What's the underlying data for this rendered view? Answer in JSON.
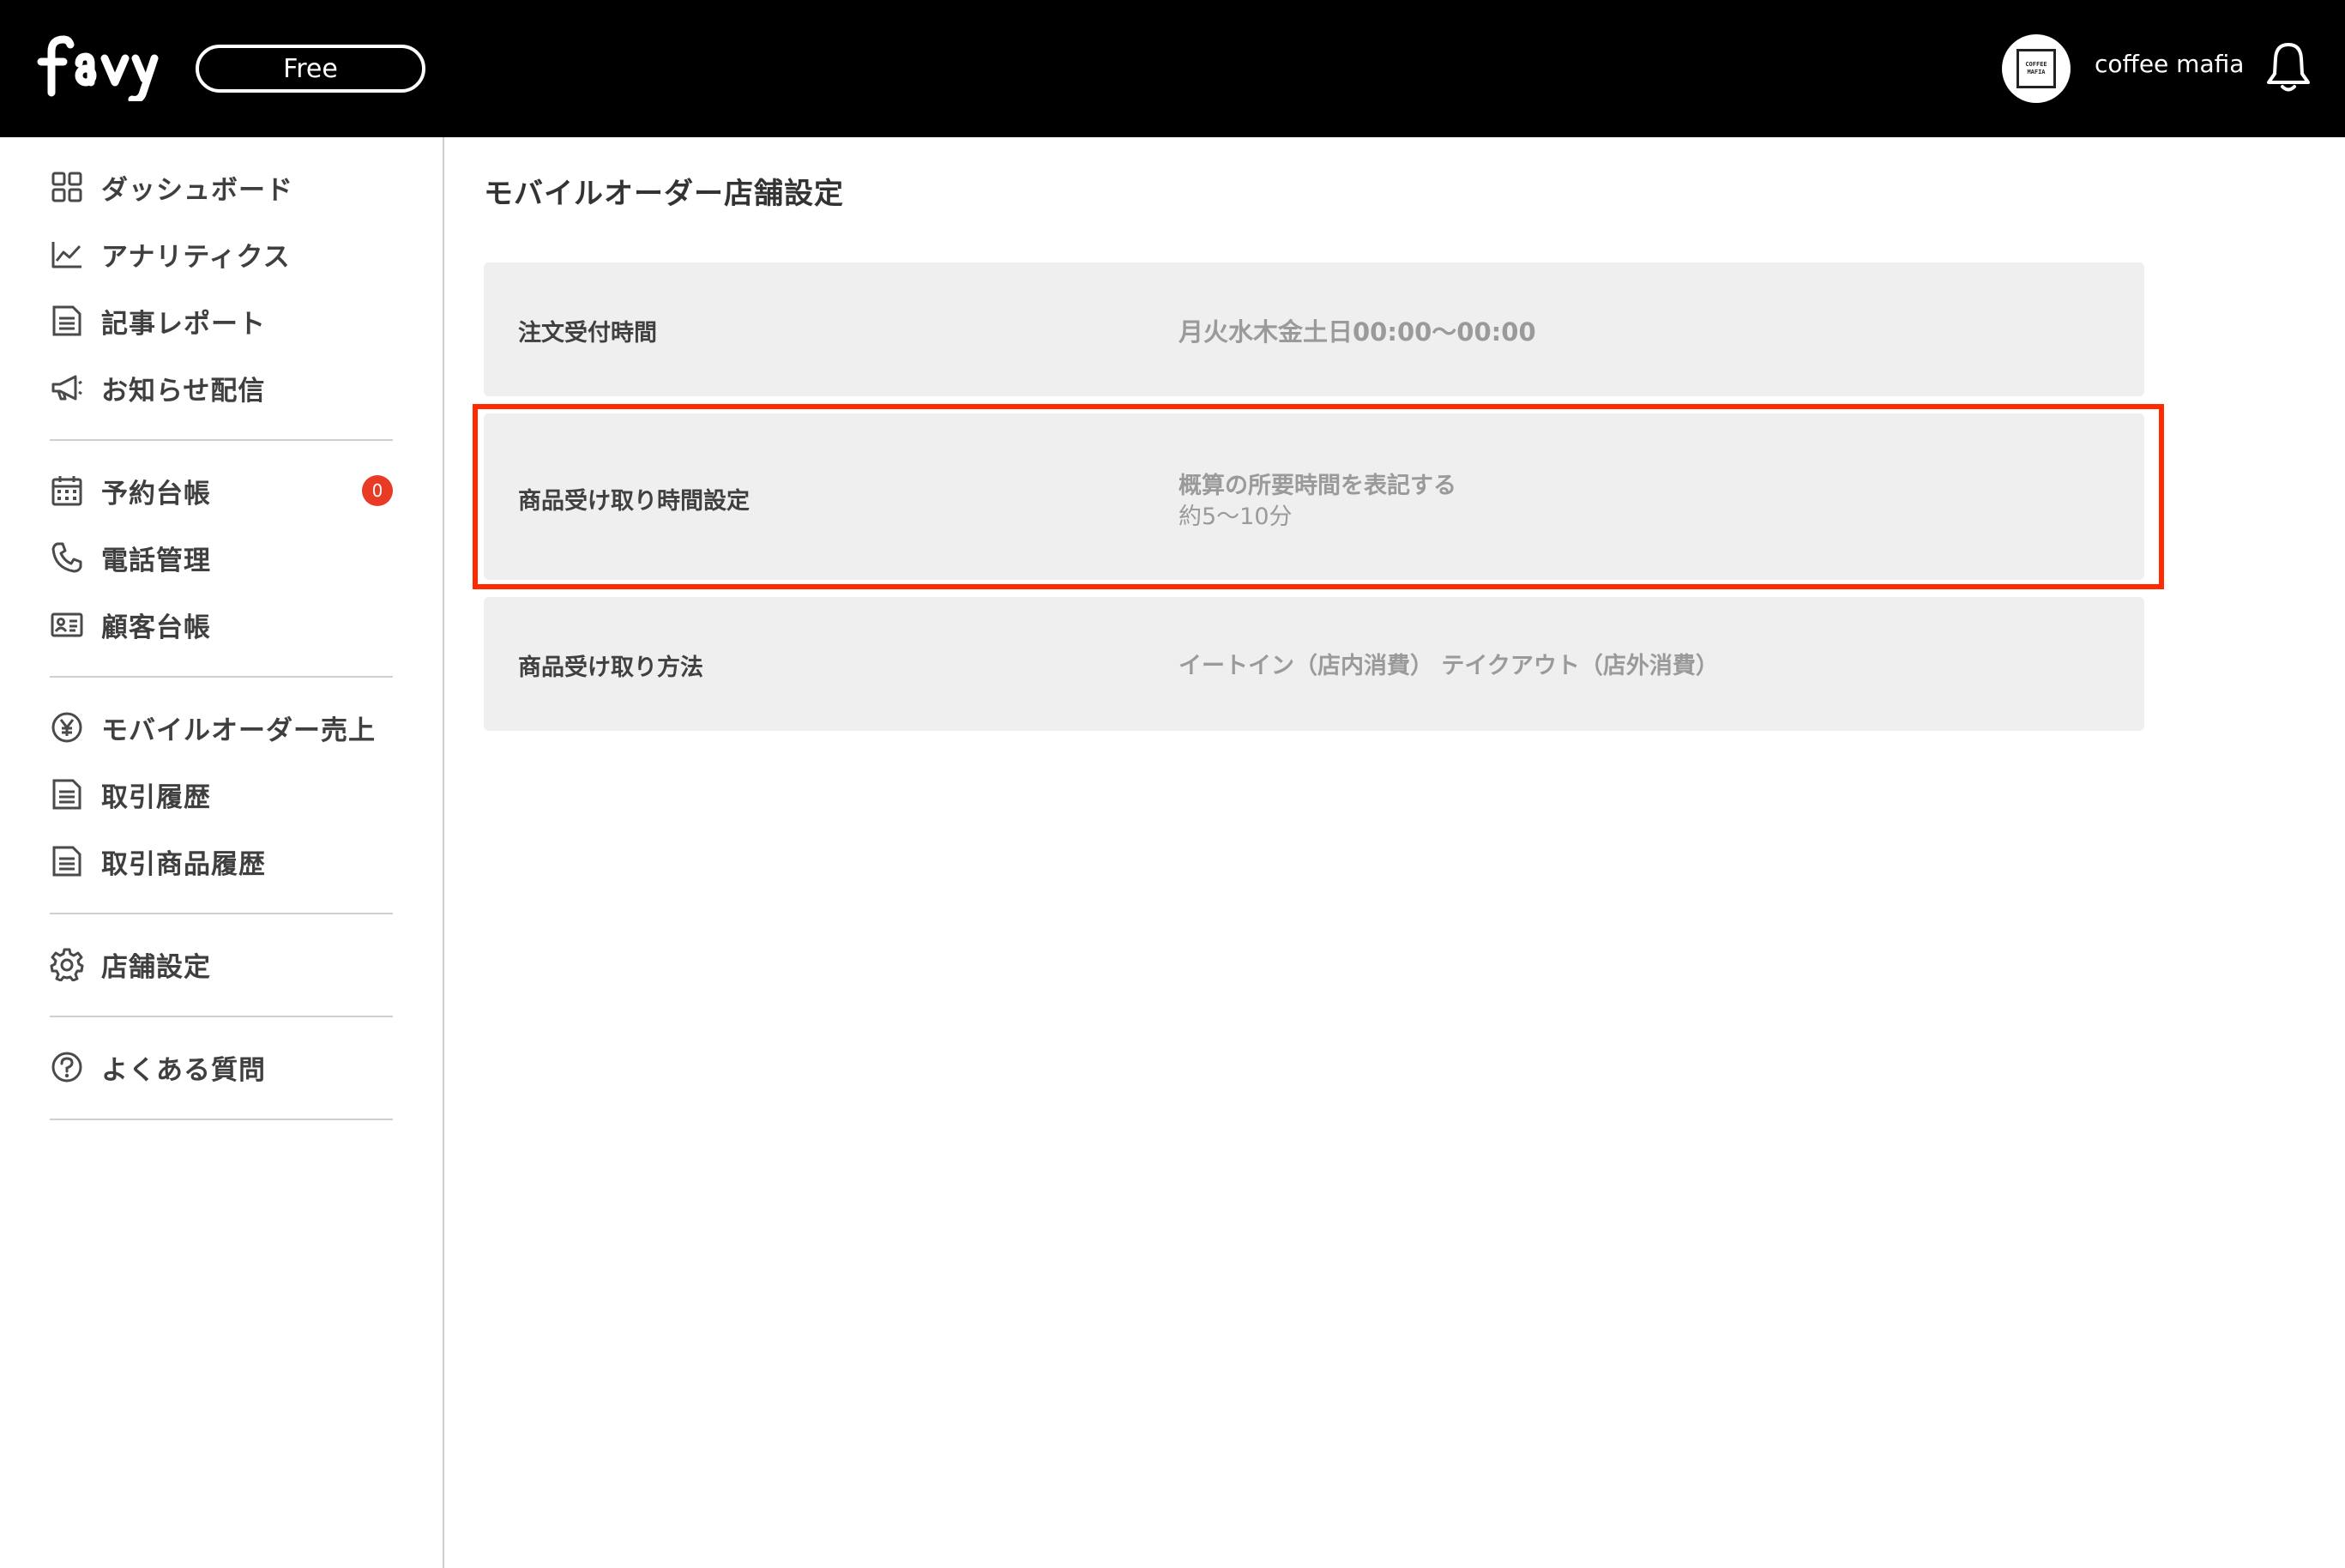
{
  "header": {
    "logo_text": "favy",
    "plan": "Free",
    "avatar_text_top": "COFFEE",
    "avatar_text_bottom": "MAFIA",
    "user_name": "coffee mafia",
    "notification_icon": "bell-icon"
  },
  "sidebar": {
    "groups": [
      [
        {
          "label": "ダッシュボード",
          "icon": "dashboard-grid-icon"
        },
        {
          "label": "アナリティクス",
          "icon": "line-chart-icon"
        },
        {
          "label": "記事レポート",
          "icon": "document-icon"
        },
        {
          "label": "お知らせ配信",
          "icon": "megaphone-icon"
        }
      ],
      [
        {
          "label": "予約台帳",
          "icon": "calendar-icon",
          "badge": "0"
        },
        {
          "label": "電話管理",
          "icon": "phone-icon"
        },
        {
          "label": "顧客台帳",
          "icon": "id-card-icon"
        }
      ],
      [
        {
          "label": "モバイルオーダー売上",
          "icon": "yen-circle-icon"
        },
        {
          "label": "取引履歴",
          "icon": "document-icon"
        },
        {
          "label": "取引商品履歴",
          "icon": "document-icon"
        }
      ],
      [
        {
          "label": "店舗設定",
          "icon": "gear-icon"
        }
      ],
      [
        {
          "label": "よくある質問",
          "icon": "question-circle-icon"
        }
      ]
    ]
  },
  "main": {
    "title": "モバイルオーダー店舗設定",
    "settings": [
      {
        "label": "注文受付時間",
        "value": "月火水木金土日00:00〜00:00"
      },
      {
        "label": "商品受け取り時間設定",
        "value": "概算の所要時間を表記する",
        "sub_value": "約5〜10分",
        "highlighted": true
      },
      {
        "label": "商品受け取り方法",
        "value": "イートイン（店内消費） テイクアウト（店外消費）"
      }
    ]
  },
  "colors": {
    "header_bg": "#000000",
    "badge": "#e83a25",
    "highlight": "#ff2a00",
    "card_bg": "#efefef"
  }
}
